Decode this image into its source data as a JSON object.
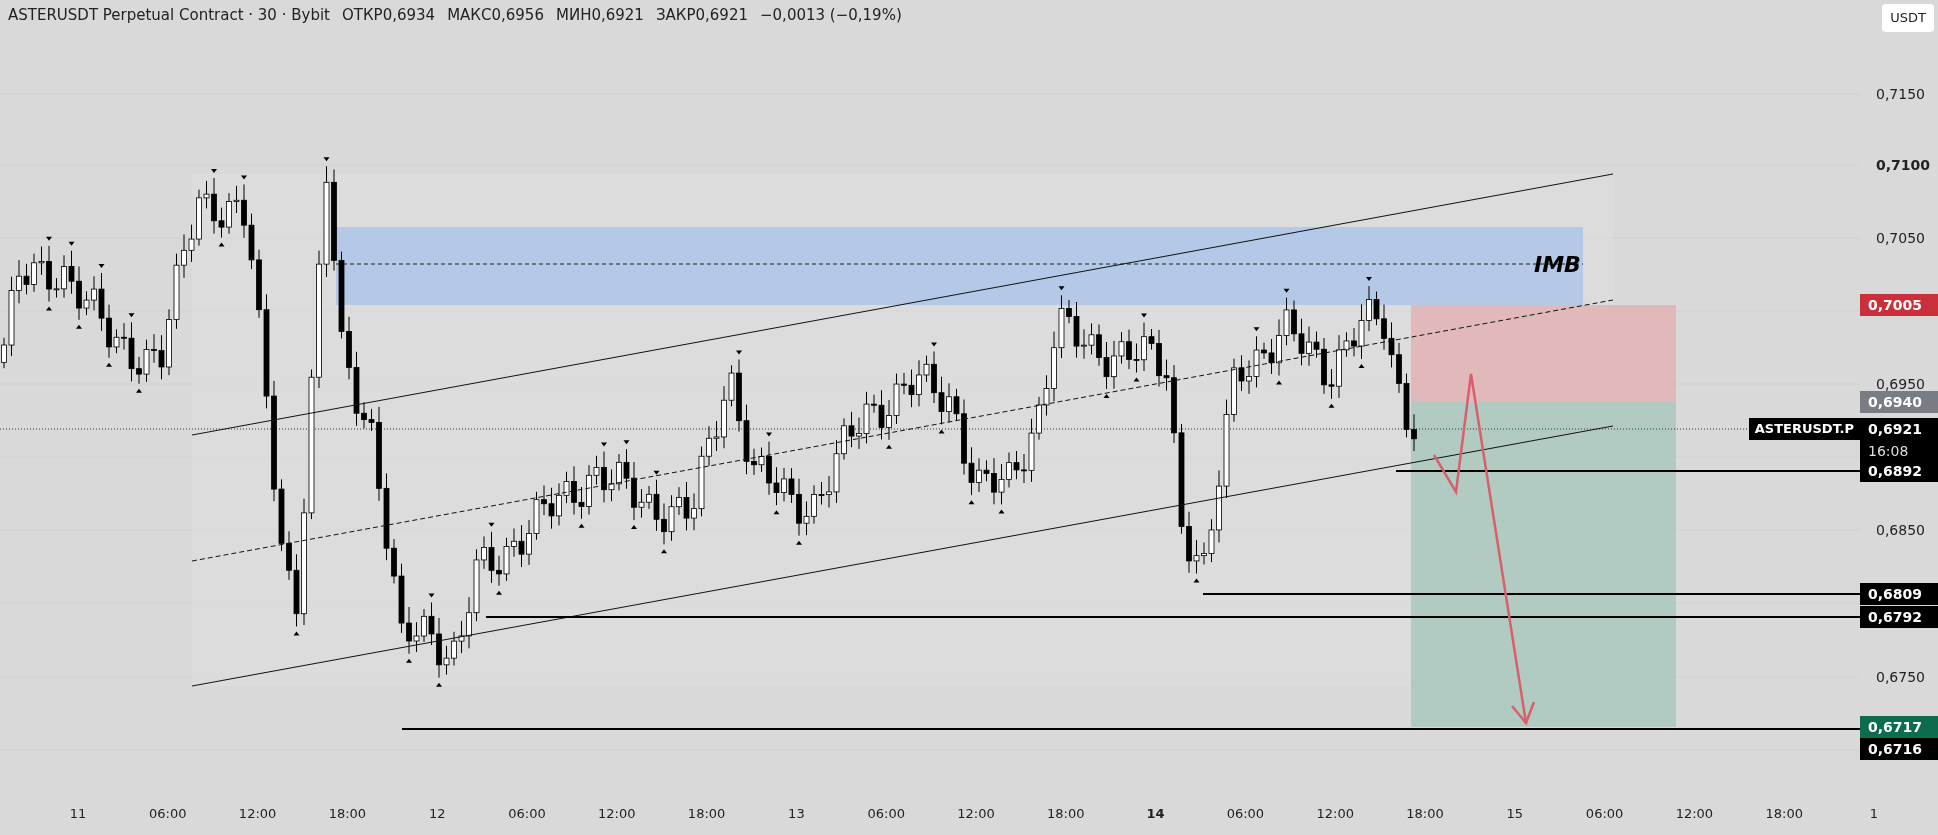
{
  "legend": {
    "title": "ASTERUSDT Perpetual Contract · 30 · Bybit",
    "ohlc": [
      {
        "label": "ОТКР",
        "value": "0,6934"
      },
      {
        "label": "МАКС",
        "value": "0,6956"
      },
      {
        "label": "МИН",
        "value": "0,6921"
      },
      {
        "label": "ЗАКР",
        "value": "0,6921"
      }
    ],
    "change": "−0,0013 (−0,19%)"
  },
  "chart": {
    "zone_label": "IMB",
    "symbol_tag": "ASTERUSDT.P"
  },
  "price_axis": {
    "unit": "USDT",
    "ticks": [
      {
        "label": "0,7150",
        "emphasized": false
      },
      {
        "label": "0,7100",
        "emphasized": true
      },
      {
        "label": "0,7050",
        "emphasized": false
      },
      {
        "label": "0,6950",
        "emphasized": false
      },
      {
        "label": "0,6850",
        "emphasized": false
      },
      {
        "label": "0,6750",
        "emphasized": false
      }
    ],
    "tags": [
      {
        "value": "0,7005",
        "color": "#cc2f3c"
      },
      {
        "value": "0,6940",
        "color": "#797c85"
      },
      {
        "value": "0,6921",
        "color": "#000000",
        "countdown": "16:08"
      },
      {
        "value": "0,6892",
        "color": "#000000"
      },
      {
        "value": "0,6809",
        "color": "#000000"
      },
      {
        "value": "0,6792",
        "color": "#000000"
      },
      {
        "value": "0,6717",
        "color": "#0d6b50"
      },
      {
        "value": "0,6716",
        "color": "#000000"
      }
    ]
  },
  "time_axis": [
    {
      "label": "11",
      "emphasized": false
    },
    {
      "label": "06:00",
      "emphasized": false
    },
    {
      "label": "12:00",
      "emphasized": false
    },
    {
      "label": "18:00",
      "emphasized": false
    },
    {
      "label": "12",
      "emphasized": false
    },
    {
      "label": "06:00",
      "emphasized": false
    },
    {
      "label": "12:00",
      "emphasized": false
    },
    {
      "label": "18:00",
      "emphasized": false
    },
    {
      "label": "13",
      "emphasized": false
    },
    {
      "label": "06:00",
      "emphasized": false
    },
    {
      "label": "12:00",
      "emphasized": false
    },
    {
      "label": "18:00",
      "emphasized": false
    },
    {
      "label": "14",
      "emphasized": true
    },
    {
      "label": "06:00",
      "emphasized": false
    },
    {
      "label": "12:00",
      "emphasized": false
    },
    {
      "label": "18:00",
      "emphasized": false
    },
    {
      "label": "15",
      "emphasized": false
    },
    {
      "label": "06:00",
      "emphasized": false
    },
    {
      "label": "12:00",
      "emphasized": false
    },
    {
      "label": "18:00",
      "emphasized": false
    },
    {
      "label": "1",
      "emphasized": false
    }
  ]
}
